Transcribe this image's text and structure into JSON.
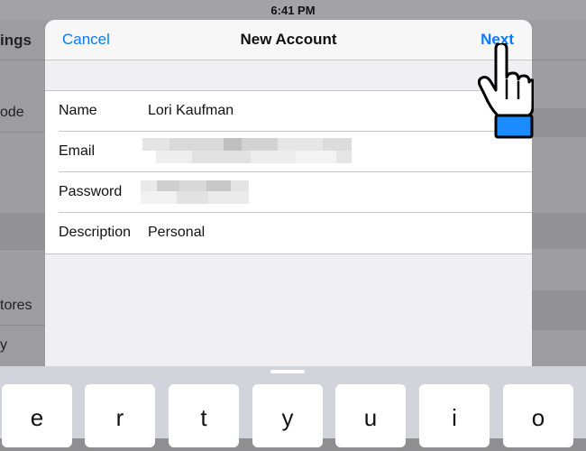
{
  "status_bar": {
    "time": "6:41 PM"
  },
  "background": {
    "title_fragment": "ings",
    "items": [
      "ode",
      "tores",
      "y"
    ]
  },
  "modal": {
    "cancel_label": "Cancel",
    "title": "New Account",
    "next_label": "Next",
    "fields": [
      {
        "label": "Name",
        "value": "Lori Kaufman"
      },
      {
        "label": "Email",
        "value": ""
      },
      {
        "label": "Password",
        "value": ""
      },
      {
        "label": "Description",
        "value": "Personal"
      }
    ]
  },
  "keyboard": {
    "keys": [
      "e",
      "r",
      "t",
      "y",
      "u",
      "i",
      "o"
    ]
  },
  "colors": {
    "accent": "#0a7aff",
    "cursor_cuff": "#1a8cff"
  },
  "icons": [
    "hand-pointer-icon"
  ]
}
